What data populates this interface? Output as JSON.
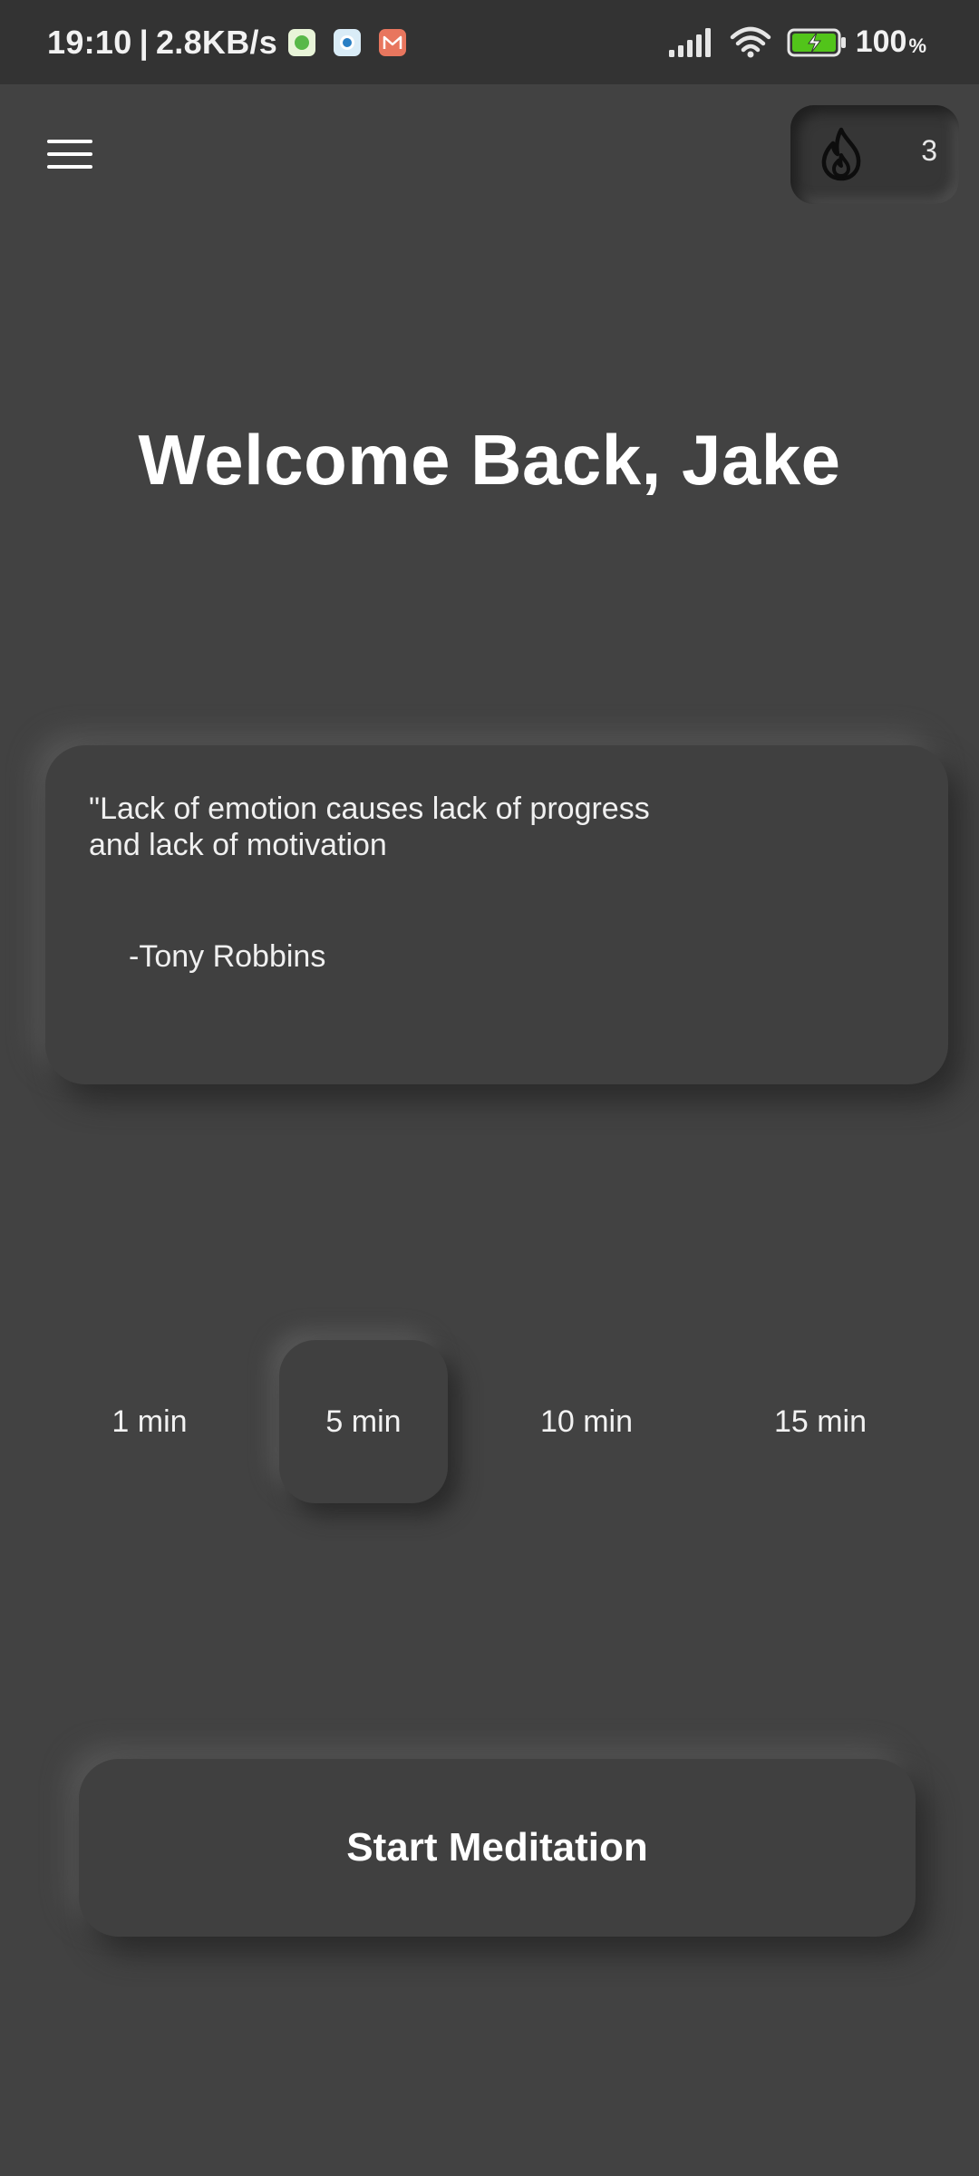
{
  "status_bar": {
    "time": "19:10",
    "separator": "|",
    "network_speed": "2.8KB/s",
    "battery_percent": "100",
    "battery_percent_sign": "%",
    "notification_icons": [
      "green-app-icon",
      "blue-app-icon",
      "mail-app-icon"
    ],
    "system_icons": [
      "signal-icon",
      "wifi-icon",
      "battery-charging-icon"
    ]
  },
  "header": {
    "menu_icon": "hamburger-menu-icon",
    "streak": {
      "icon": "flame-icon",
      "count": "3"
    }
  },
  "welcome": {
    "title": "Welcome Back, Jake"
  },
  "quote": {
    "text": "\"Lack of emotion causes lack of progress\n and lack of motivation",
    "author": "-Tony Robbins"
  },
  "durations": {
    "options": [
      "1 min",
      "5 min",
      "10 min",
      "15 min"
    ],
    "selected": "5 min"
  },
  "actions": {
    "start_label": "Start Meditation"
  },
  "colors": {
    "background": "#424242",
    "status_bar": "#333333",
    "card": "#404040",
    "text": "#ffffff",
    "battery_green": "#52c41a"
  }
}
